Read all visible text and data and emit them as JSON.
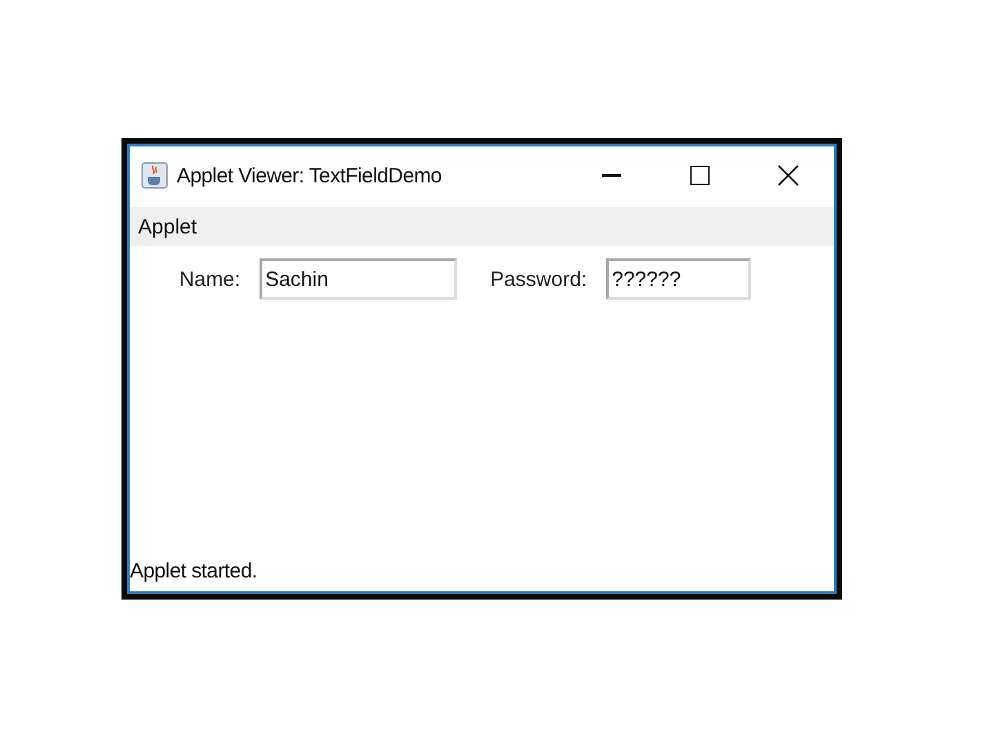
{
  "window": {
    "title": "Applet Viewer: TextFieldDemo"
  },
  "menu": [
    "Applet"
  ],
  "fields": [
    {
      "label": "Name:",
      "value": "Sachin"
    },
    {
      "label": "Password:",
      "value": "??????"
    }
  ],
  "status_bar": "Applet started."
}
